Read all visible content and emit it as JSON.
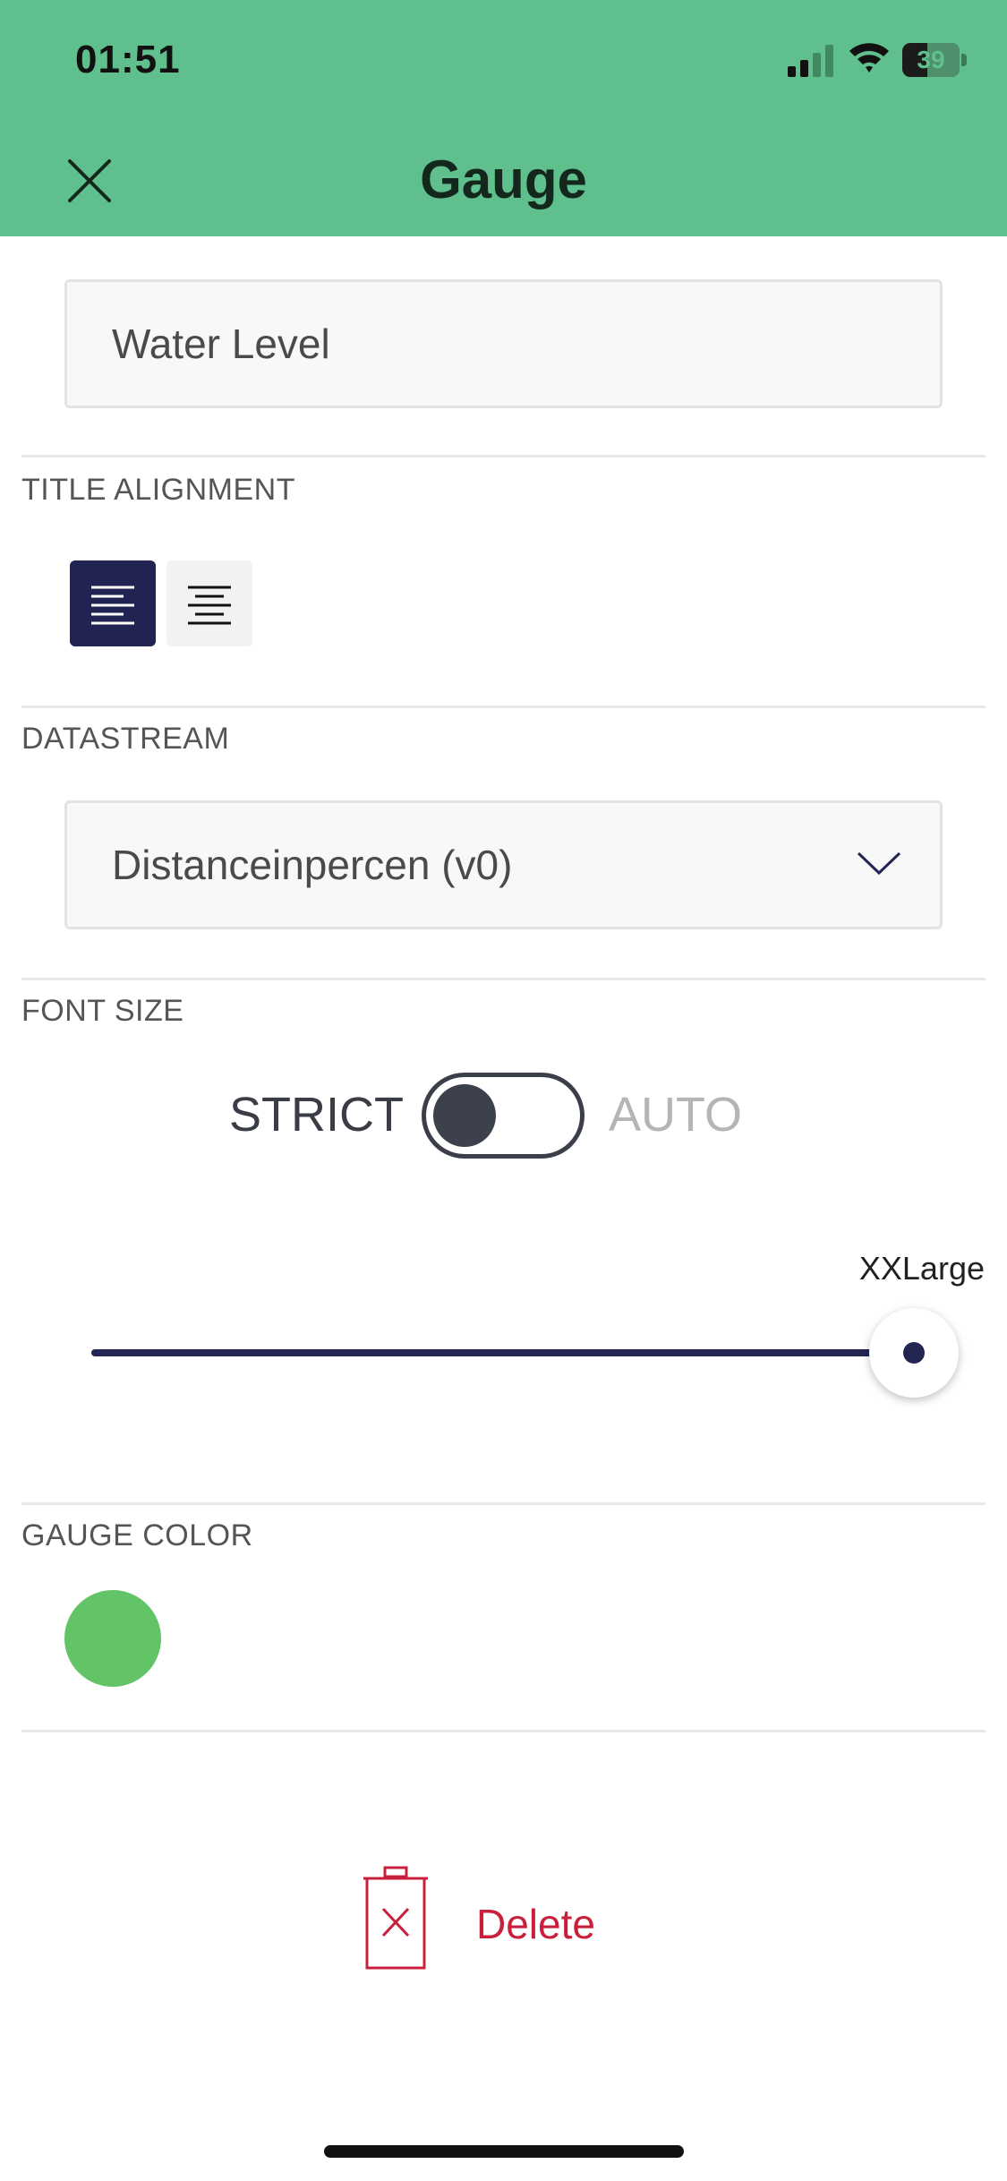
{
  "status_bar": {
    "time": "01:51",
    "battery": "39"
  },
  "header": {
    "title": "Gauge",
    "close_icon": "close-icon",
    "background_color": "#5fc08e"
  },
  "title_field": {
    "value": "Water Level"
  },
  "title_alignment": {
    "label": "TITLE ALIGNMENT",
    "options": [
      "left",
      "center"
    ],
    "selected": "left"
  },
  "datastream": {
    "label": "DATASTREAM",
    "selected": "Distanceinpercen (v0)"
  },
  "font_size": {
    "label": "FONT SIZE",
    "strict_label": "STRICT",
    "auto_label": "AUTO",
    "mode": "STRICT",
    "size_value": "XXLarge",
    "slider_level": 1.0
  },
  "gauge_color": {
    "label": "GAUGE COLOR",
    "color": "#62c467"
  },
  "delete": {
    "label": "Delete",
    "color": "#c8203c"
  },
  "accent_color": "#232652"
}
